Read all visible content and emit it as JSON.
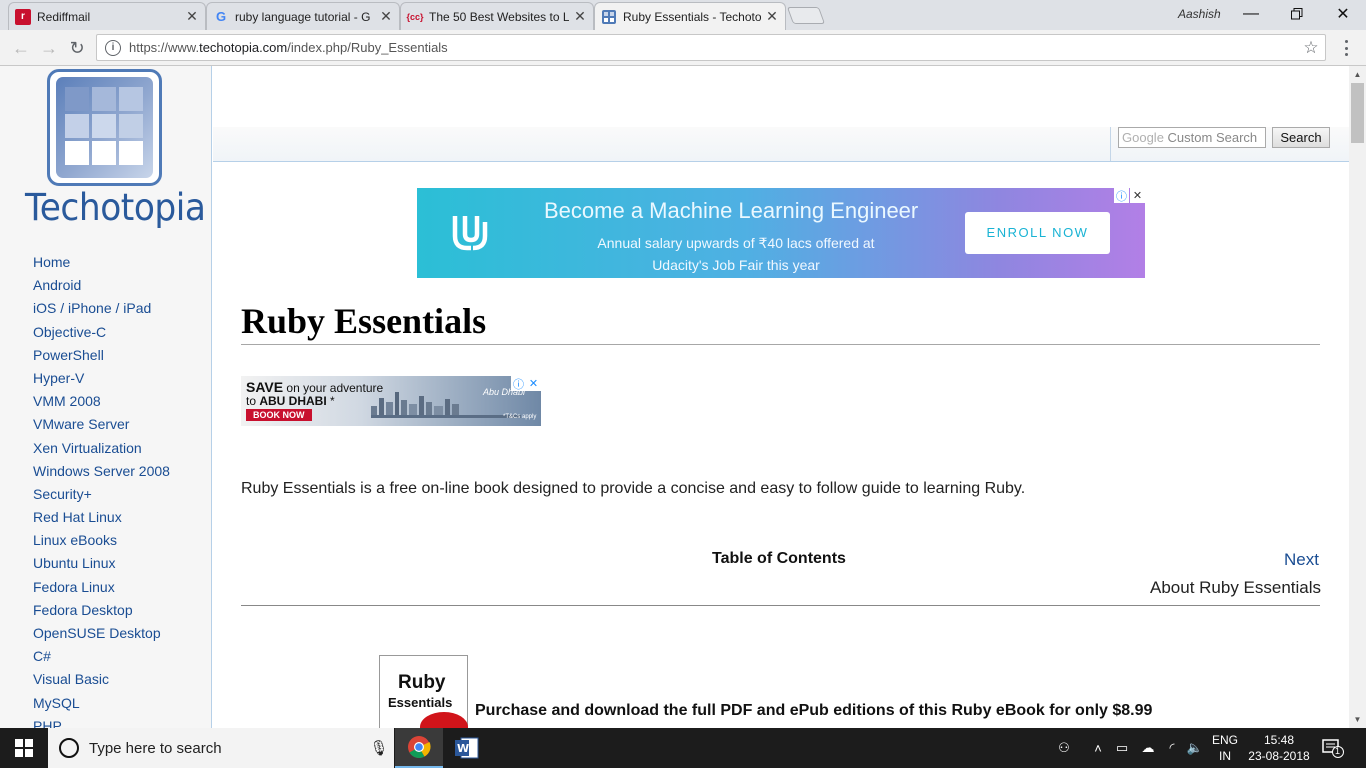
{
  "browser": {
    "tabs": [
      {
        "title": "Rediffmail",
        "icon": "rediffmail-icon",
        "active": false
      },
      {
        "title": "ruby language tutorial - G",
        "icon": "google-icon",
        "active": false
      },
      {
        "title": "The 50 Best Websites to L",
        "icon": "codecademy-icon",
        "active": false
      },
      {
        "title": "Ruby Essentials - Techoto",
        "icon": "techotopia-icon",
        "active": true
      }
    ],
    "profile_name": "Aashish",
    "url_prefix": "https://www.",
    "url_domain": "techotopia.com",
    "url_path": "/index.php/Ruby_Essentials"
  },
  "sidebar": {
    "logo_text": "Techotopia",
    "nav": [
      "Home",
      "Android",
      "iOS / iPhone / iPad",
      "Objective-C",
      "PowerShell",
      "Hyper-V",
      "VMM 2008",
      "VMware Server",
      "Xen Virtualization",
      "Windows Server 2008",
      "Security+",
      "Red Hat Linux",
      "Linux eBooks",
      "Ubuntu Linux",
      "Fedora Linux",
      "Fedora Desktop",
      "OpenSUSE Desktop",
      "C#",
      "Visual Basic",
      "MySQL",
      "PHP"
    ]
  },
  "search": {
    "google_prefix": "Google",
    "placeholder": "Custom Search",
    "button": "Search"
  },
  "ad_udacity": {
    "headline": "Become a Machine Learning Engineer",
    "line1": "Annual salary upwards of ₹40 lacs offered at",
    "line2": "Udacity's Job Fair this year",
    "cta": "ENROLL NOW"
  },
  "article": {
    "title": "Ruby Essentials",
    "intro": "Ruby Essentials is a free on-line book designed to provide a concise and easy to follow guide to learning Ruby.",
    "toc_label": "Table of Contents",
    "next_label": "Next",
    "next_title": "About Ruby Essentials",
    "book_title_1": "Ruby",
    "book_title_2": "Essentials",
    "purchase_text": "Purchase and download the full PDF and ePub editions of this Ruby eBook for only $8.99"
  },
  "ad_abudhabi": {
    "save": "SAVE",
    "line1_rest": " on your adventure",
    "line2_prefix": "to ",
    "line2_place": "ABU DHABI",
    "line2_suffix": " *",
    "cta": "BOOK NOW",
    "brand": "Abu Dhabi",
    "terms": "*T&Cs apply"
  },
  "taskbar": {
    "search_placeholder": "Type here to search",
    "lang_line1": "ENG",
    "lang_line2": "IN",
    "time": "15:48",
    "date": "23-08-2018",
    "notification_count": "1"
  },
  "colors": {
    "link": "#1a4d93",
    "logo_blue": "#4f7ab7",
    "udacity_cyan": "#2bbfd6",
    "udacity_purple": "#b27fe6"
  }
}
